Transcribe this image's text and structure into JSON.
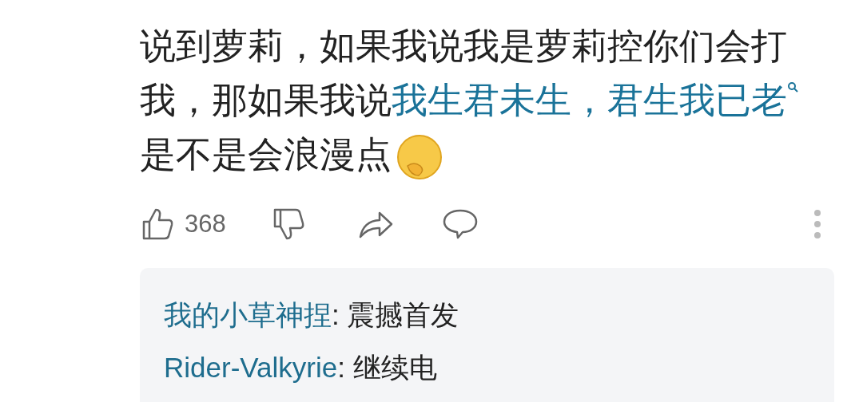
{
  "comment": {
    "text_before": "说到萝莉，如果我说我是萝莉控你们会打我，那如果我说",
    "link": "我生君未生，君生我已老",
    "text_after": "是不是会浪漫点"
  },
  "actions": {
    "like_count": "368"
  },
  "replies": [
    {
      "user": "我的小草神捏",
      "separator": ":",
      "text": "震撼首发"
    },
    {
      "user": "Rider-Valkyrie",
      "separator": ":",
      "text": "继续电"
    }
  ]
}
